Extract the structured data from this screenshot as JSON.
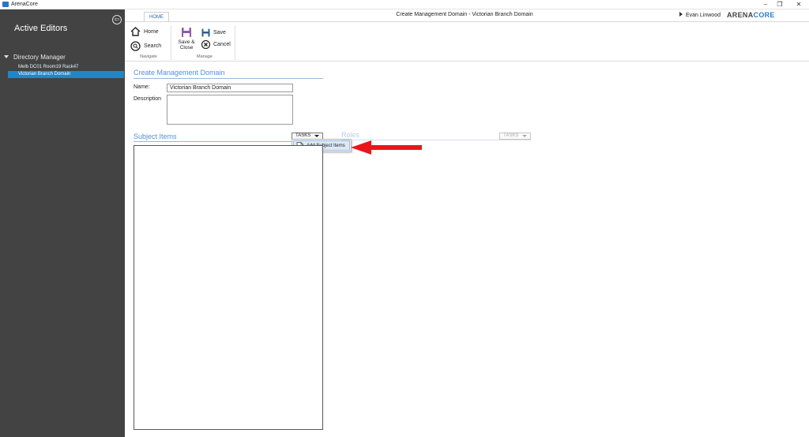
{
  "window": {
    "app_title": "ArenaCore",
    "controls": {
      "minimize": "–",
      "restore": "❐",
      "close": "✕"
    }
  },
  "sidebar": {
    "collapse_glyph": "⇦",
    "title": "Active Editors",
    "group": "Directory Manager",
    "items": [
      {
        "label": "Melb DC01 Room19 Rack47",
        "selected": false
      },
      {
        "label": "Victorian Branch Domain",
        "selected": true
      }
    ]
  },
  "ribbon": {
    "tab": "HOME",
    "window_title": "Create Management Domain - Victorian Branch Domain",
    "user": "Evan Linwood",
    "brand": {
      "part1": "ARENA",
      "part2": "CORE",
      "accent_color": "#2a7fc0"
    },
    "navigate": {
      "label": "Navigate",
      "home": "Home",
      "search": "Search"
    },
    "manage": {
      "label": "Manage",
      "save_close_line1": "Save &",
      "save_close_line2": "Close",
      "save": "Save",
      "cancel": "Cancel"
    }
  },
  "form": {
    "heading": "Create Management Domain",
    "name_label": "Name:",
    "name_value": "Victorian Branch Domain",
    "description_label": "Description",
    "description_value": ""
  },
  "subject_items": {
    "title": "Subject Items",
    "tasks_label": "TASKS",
    "menu_item": "Add Subject Items"
  },
  "roles": {
    "title": "Roles",
    "tasks_label": "TASKS"
  },
  "colors": {
    "sidebar_bg": "#434343",
    "selection": "#1f86c9",
    "heading": "#5a8fcb",
    "arrow": "#e8161b"
  }
}
